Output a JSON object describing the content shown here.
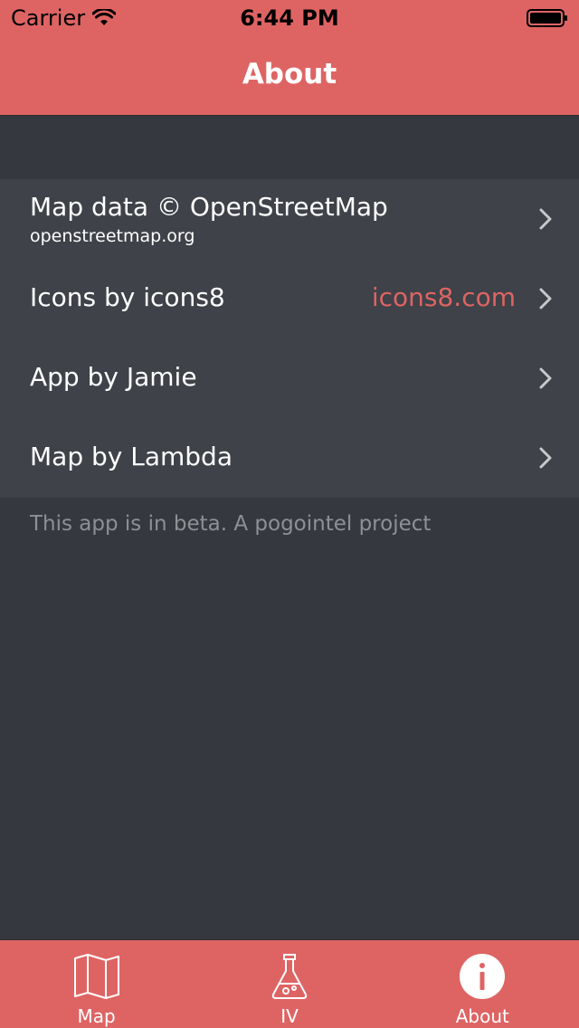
{
  "status_bar": {
    "carrier": "Carrier",
    "time": "6:44 PM",
    "wifi_icon": "wifi-icon",
    "battery_icon": "battery-icon"
  },
  "nav": {
    "title": "About"
  },
  "rows": [
    {
      "title": "Map data © OpenStreetMap",
      "subtitle": "openstreetmap.org",
      "detail": ""
    },
    {
      "title": "Icons by icons8",
      "subtitle": "",
      "detail": "icons8.com"
    },
    {
      "title": "App by Jamie",
      "subtitle": "",
      "detail": ""
    },
    {
      "title": "Map by Lambda",
      "subtitle": "",
      "detail": ""
    }
  ],
  "footer_note": "This app is in beta. A pogointel project",
  "tabs": [
    {
      "label": "Map",
      "icon": "map-icon",
      "selected": false
    },
    {
      "label": "IV",
      "icon": "flask-icon",
      "selected": false
    },
    {
      "label": "About",
      "icon": "info-icon",
      "selected": true
    }
  ],
  "colors": {
    "accent": "#de6464",
    "background": "#35383e",
    "cell": "#3f4248",
    "footer_text": "#8e9094"
  }
}
